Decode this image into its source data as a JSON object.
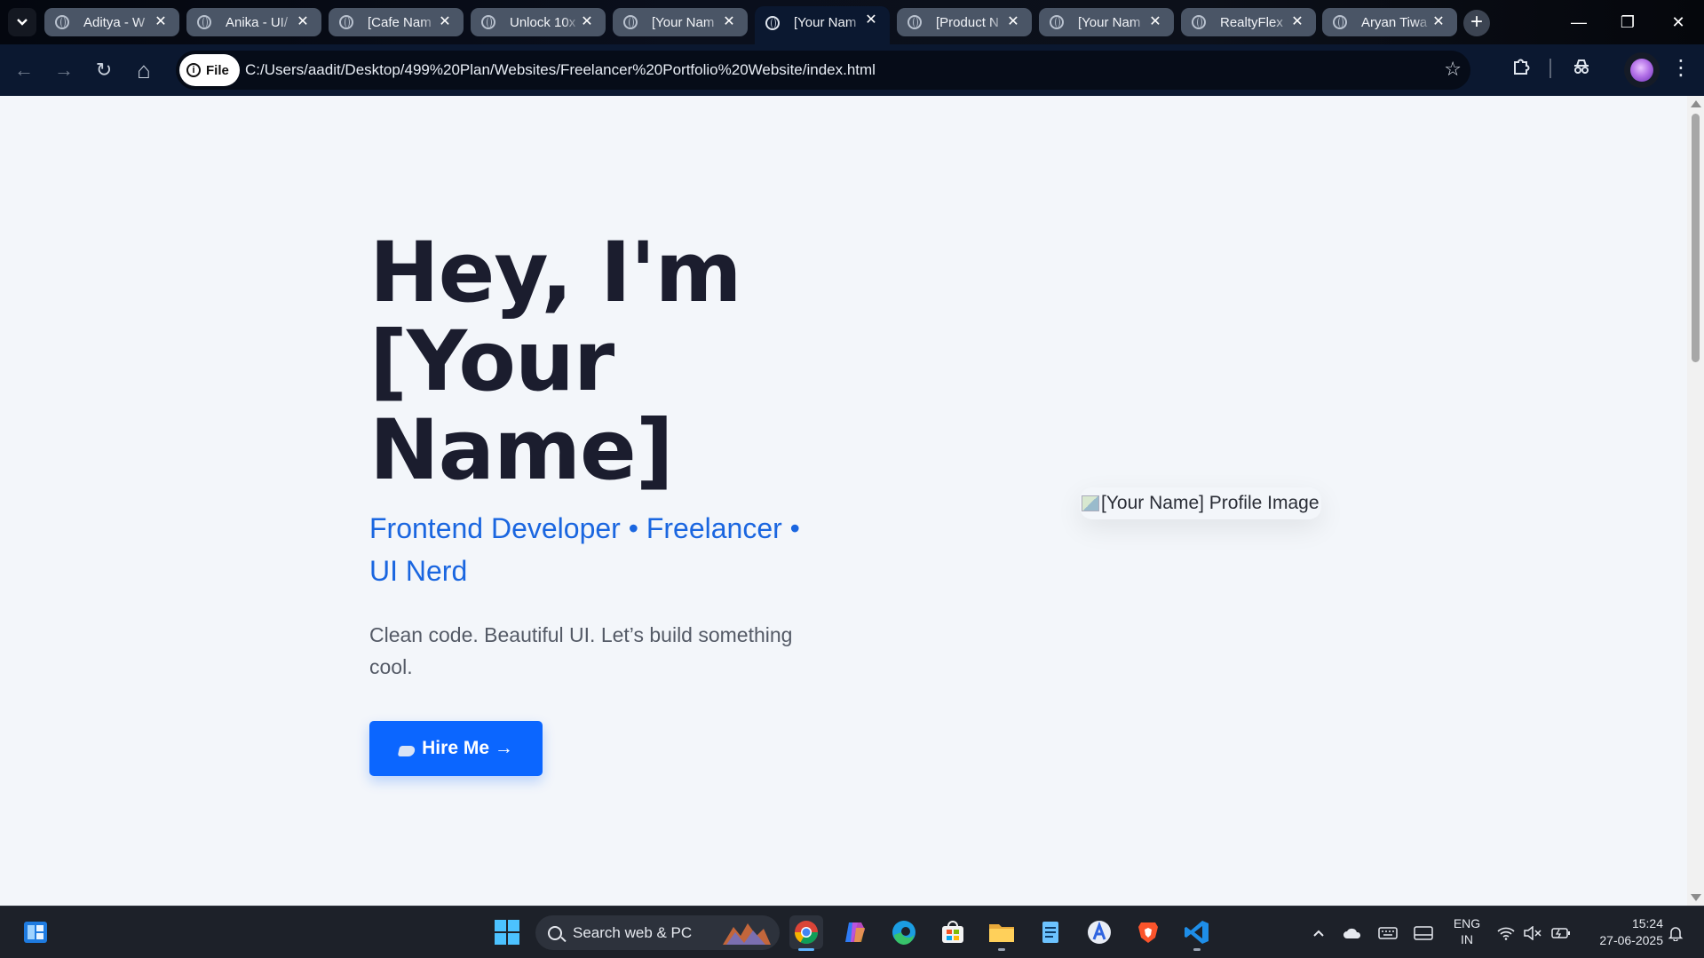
{
  "tabs": [
    {
      "title": "Aditya - W"
    },
    {
      "title": "Anika - UI/"
    },
    {
      "title": "[Cafe Nam"
    },
    {
      "title": "Unlock 10x"
    },
    {
      "title": "[Your Nam"
    },
    {
      "title": "[Your Nam",
      "active": true
    },
    {
      "title": "[Product N"
    },
    {
      "title": "[Your Nam"
    },
    {
      "title": "RealtyFlex"
    },
    {
      "title": "Aryan Tiwa"
    }
  ],
  "tab_close_glyph": "✕",
  "new_tab_glyph": "+",
  "window_controls": {
    "minimize": "—",
    "restore": "❐",
    "close": "✕"
  },
  "toolbar": {
    "back": "←",
    "forward": "→",
    "reload": "↻",
    "home": "⌂",
    "file_chip_label": "File",
    "info_glyph": "i",
    "url": "C:/Users/aadit/Desktop/499%20Plan/Websites/Freelancer%20Portfolio%20Website/index.html",
    "star": "☆",
    "extensions_icon": "puzzle-icon",
    "incognito_icon": "incognito-icon",
    "menu": "⋮"
  },
  "page": {
    "title_line1": "Hey, I'm",
    "title_line2": "[Your",
    "title_line3": "Name]",
    "subtitle": "Frontend Developer • Freelancer • UI Nerd",
    "description": "Clean code. Beautiful UI. Let’s build something cool.",
    "hire_button": "Hire Me →",
    "profile_image_alt": "[Your Name] Profile Image"
  },
  "taskbar": {
    "search_placeholder": "Search web & PC",
    "language_line1": "ENG",
    "language_line2": "IN",
    "time": "15:24",
    "date": "27-06-2025",
    "apps": [
      "widgets-icon",
      "start-icon",
      "chrome-icon",
      "copilot-icon",
      "edge-icon",
      "store-icon",
      "file-explorer-icon",
      "notepad-icon",
      "arc-icon",
      "brave-icon",
      "vscode-icon"
    ],
    "tray": [
      "chevron-up-icon",
      "onedrive-icon",
      "keyboard-icon",
      "display-icon",
      "wifi-icon",
      "volume-muted-icon",
      "battery-icon",
      "notification-icon"
    ]
  },
  "colors": {
    "accent_blue": "#0b66ff",
    "subtitle_blue": "#1a66e0",
    "heading_dark": "#1b1d2e",
    "page_bg": "#f3f6fa",
    "toolbar_bg": "#0b1830"
  }
}
